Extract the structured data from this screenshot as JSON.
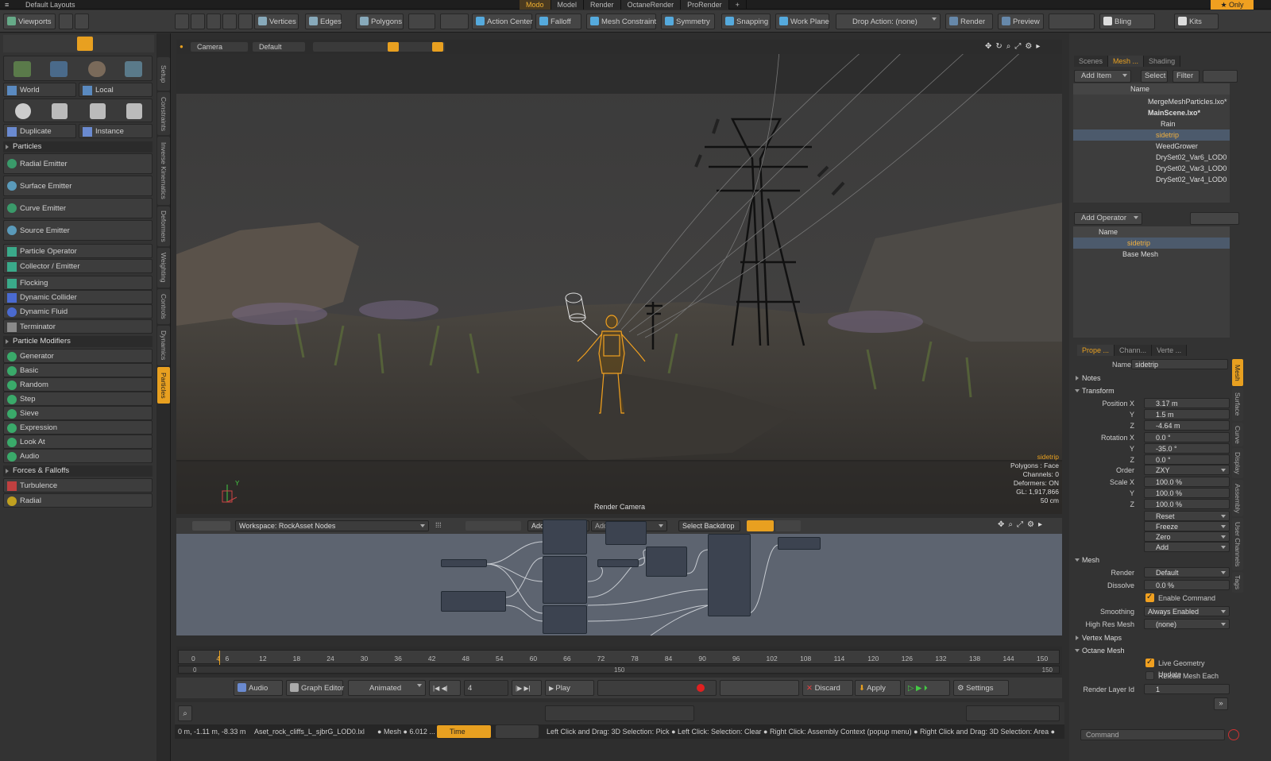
{
  "menubar": {
    "layout": "Default Layouts",
    "tabs": [
      "Modo",
      "Model",
      "Render",
      "OctaneRender",
      "ProRender"
    ],
    "only": "Only"
  },
  "toolbar": {
    "viewports": "Viewports",
    "vertices": "Vertices",
    "edges": "Edges",
    "polygons": "Polygons",
    "action_center": "Action Center",
    "falloff": "Falloff",
    "mesh_constraint": "Mesh Constraint",
    "symmetry": "Symmetry",
    "snapping": "Snapping",
    "work_plane": "Work Plane",
    "drop_action": "Drop Action: (none)",
    "render": "Render",
    "preview": "Preview",
    "bling": "Bling",
    "kits": "Kits"
  },
  "left": {
    "world": "World",
    "local": "Local",
    "duplicate": "Duplicate",
    "instance": "Instance",
    "particles": "Particles",
    "radial_emitter": "Radial Emitter",
    "surface_emitter": "Surface Emitter",
    "curve_emitter": "Curve Emitter",
    "source_emitter": "Source Emitter",
    "particle_operator": "Particle Operator",
    "collector_emitter": "Collector / Emitter",
    "flocking": "Flocking",
    "dynamic_collider": "Dynamic Collider",
    "dynamic_fluid": "Dynamic Fluid",
    "terminator": "Terminator",
    "particle_modifiers": "Particle Modifiers",
    "generator": "Generator",
    "basic": "Basic",
    "random": "Random",
    "step": "Step",
    "sieve": "Sieve",
    "expression": "Expression",
    "look_at": "Look At",
    "audio": "Audio",
    "forces_falloffs": "Forces & Falloffs",
    "turbulence": "Turbulence",
    "radial": "Radial"
  },
  "vtabs": [
    "Setup",
    "Constraints",
    "Inverse Kinematics",
    "Deformers",
    "Weighting",
    "Controls",
    "Dynamics",
    "Particles"
  ],
  "viewport": {
    "camera": "Camera",
    "default": "Default",
    "render_camera": "Render Camera",
    "item": "sidetrip",
    "info": [
      "Polygons : Face",
      "Channels: 0",
      "Deformers: ON",
      "GL: 1,917,866",
      "50 cm"
    ],
    "axis_y": "Y"
  },
  "node": {
    "workspace": "Workspace: RockAsset Nodes",
    "add_selected": "Add Selected",
    "add": "Add...",
    "select_backdrop": "Select Backdrop"
  },
  "timeline": {
    "ticks": [
      "0",
      "6",
      "12",
      "18",
      "24",
      "30",
      "36",
      "42",
      "48",
      "54",
      "60",
      "66",
      "72",
      "78",
      "84",
      "90",
      "96",
      "102",
      "108",
      "114",
      "120",
      "126",
      "132",
      "138",
      "144",
      "150"
    ],
    "current": "4",
    "sub_start": "0",
    "sub_mid": "150",
    "sub_end": "150"
  },
  "transport": {
    "audio": "Audio",
    "graph_editor": "Graph Editor",
    "animated": "Animated",
    "frame": "4",
    "play": "Play",
    "discard": "Discard",
    "apply": "Apply",
    "settings": "Settings"
  },
  "bottom": {
    "coords": "0 m, -1.11 m, -8.33 m",
    "asset": "Aset_rock_cliffs_L_sjbrG_LOD0.lxl",
    "mesh": "Mesh",
    "val": "6.012",
    "time": "Time",
    "hints": "Left Click and Drag: 3D Selection: Pick ● Left Click: Selection: Clear ● Right Click: Assembly Context (popup menu) ● Right Click and Drag: 3D Selection: Area ●"
  },
  "right": {
    "tabs": [
      "Scenes",
      "Mesh ...",
      "Shading"
    ],
    "add_item": "Add Item",
    "select": "Select",
    "filter": "Filter",
    "name_col": "Name",
    "tree": [
      "MergeMeshParticles.lxo*",
      "MainScene.lxo*",
      "Rain",
      "sidetrip",
      "WeedGrower",
      "DrySet02_Var6_LOD0",
      "DrySet02_Var3_LOD0",
      "DrySet02_Var4_LOD0"
    ],
    "add_operator": "Add Operator",
    "op_name": "Name",
    "op_sidetrip": "sidetrip",
    "base_mesh": "Base Mesh",
    "prop_tabs": [
      "Prope ...",
      "Chann...",
      "Verte ..."
    ],
    "name_label": "Name",
    "name_val": "sidetrip",
    "notes": "Notes",
    "transform": "Transform",
    "pos_x_l": "Position X",
    "pos_x": "3.17 m",
    "y_l": "Y",
    "pos_y": "1.5 m",
    "z_l": "Z",
    "pos_z": "-4.64 m",
    "rot_x_l": "Rotation X",
    "rot_x": "0.0 °",
    "rot_y": "-35.0 °",
    "rot_z": "0.0 °",
    "order_l": "Order",
    "order": "ZXY",
    "scale_x_l": "Scale X",
    "scale_x": "100.0 %",
    "scale_y": "100.0 %",
    "scale_z": "100.0 %",
    "reset": "Reset",
    "freeze": "Freeze",
    "zero": "Zero",
    "add": "Add",
    "mesh": "Mesh",
    "render_l": "Render",
    "render_v": "Default",
    "dissolve_l": "Dissolve",
    "dissolve_v": "0.0 %",
    "enable_cmd": "Enable Command Reg...",
    "smoothing_l": "Smoothing",
    "smoothing_v": "Always Enabled",
    "highres_l": "High Res Mesh",
    "highres_v": "(none)",
    "vertex_maps": "Vertex Maps",
    "octane_mesh": "Octane Mesh",
    "live_geo": "Live Geometry Update",
    "reload_mesh": "Reload Mesh Each Fra...",
    "render_layer_l": "Render Layer Id",
    "render_layer_v": "1",
    "command": "Command"
  },
  "rvtabs": [
    "Mesh",
    "Surface",
    "Curve",
    "Display",
    "Assembly",
    "User Channels",
    "Tags"
  ]
}
